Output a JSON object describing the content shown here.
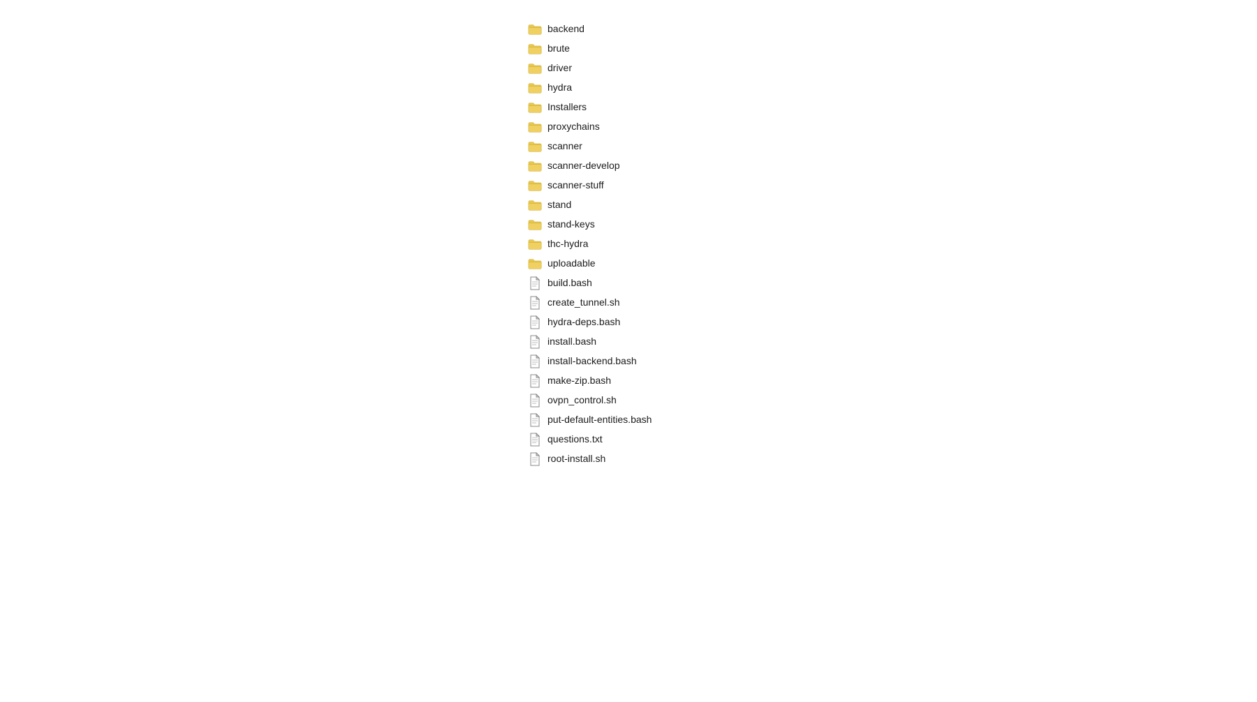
{
  "items": [
    {
      "id": "backend",
      "name": "backend",
      "type": "folder"
    },
    {
      "id": "brute",
      "name": "brute",
      "type": "folder"
    },
    {
      "id": "driver",
      "name": "driver",
      "type": "folder"
    },
    {
      "id": "hydra",
      "name": "hydra",
      "type": "folder"
    },
    {
      "id": "Installers",
      "name": "Installers",
      "type": "folder"
    },
    {
      "id": "proxychains",
      "name": "proxychains",
      "type": "folder"
    },
    {
      "id": "scanner",
      "name": "scanner",
      "type": "folder"
    },
    {
      "id": "scanner-develop",
      "name": "scanner-develop",
      "type": "folder"
    },
    {
      "id": "scanner-stuff",
      "name": "scanner-stuff",
      "type": "folder"
    },
    {
      "id": "stand",
      "name": "stand",
      "type": "folder"
    },
    {
      "id": "stand-keys",
      "name": "stand-keys",
      "type": "folder"
    },
    {
      "id": "thc-hydra",
      "name": "thc-hydra",
      "type": "folder"
    },
    {
      "id": "uploadable",
      "name": "uploadable",
      "type": "folder"
    },
    {
      "id": "build.bash",
      "name": "build.bash",
      "type": "file"
    },
    {
      "id": "create_tunnel.sh",
      "name": "create_tunnel.sh",
      "type": "file"
    },
    {
      "id": "hydra-deps.bash",
      "name": "hydra-deps.bash",
      "type": "file"
    },
    {
      "id": "install.bash",
      "name": "install.bash",
      "type": "file"
    },
    {
      "id": "install-backend.bash",
      "name": "install-backend.bash",
      "type": "file"
    },
    {
      "id": "make-zip.bash",
      "name": "make-zip.bash",
      "type": "file"
    },
    {
      "id": "ovpn_control.sh",
      "name": "ovpn_control.sh",
      "type": "file"
    },
    {
      "id": "put-default-entities.bash",
      "name": "put-default-entities.bash",
      "type": "file"
    },
    {
      "id": "questions.txt",
      "name": "questions.txt",
      "type": "file-txt"
    },
    {
      "id": "root-install.sh",
      "name": "root-install.sh",
      "type": "file"
    }
  ],
  "colors": {
    "folder": "#E8C84A",
    "folder_shadow": "#C9A830",
    "file_border": "#888888",
    "file_bg": "#ffffff",
    "txt_lines": "#aaaaaa"
  }
}
